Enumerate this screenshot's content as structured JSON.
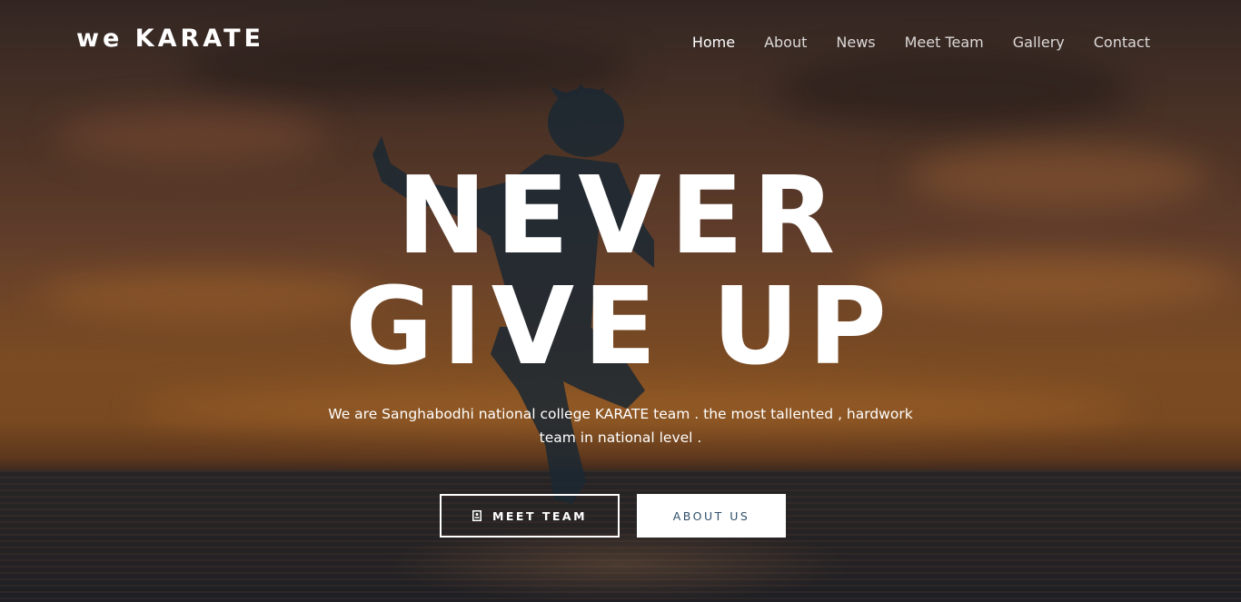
{
  "brand": {
    "name": "we KARATE"
  },
  "nav": {
    "items": [
      {
        "label": "Home",
        "active": true
      },
      {
        "label": "About"
      },
      {
        "label": "News"
      },
      {
        "label": "Meet Team"
      },
      {
        "label": "Gallery"
      },
      {
        "label": "Contact"
      }
    ]
  },
  "hero": {
    "headline_line1": "NEVER",
    "headline_line2": "GIVE UP",
    "tagline_line1": "We are Sanghabodhi national college KARATE team . the most tallented , hardwork",
    "tagline_line2": "team in national level .",
    "buttons": {
      "meet_team": {
        "label": "MEET TEAM",
        "icon": "contact-card-icon"
      },
      "about_us": {
        "label": "ABOUT US"
      }
    }
  },
  "colors": {
    "text": "#ffffff",
    "about_button_text": "#2f4f6a",
    "sky_orange": "#8c5628",
    "sea": "#2a2729"
  }
}
